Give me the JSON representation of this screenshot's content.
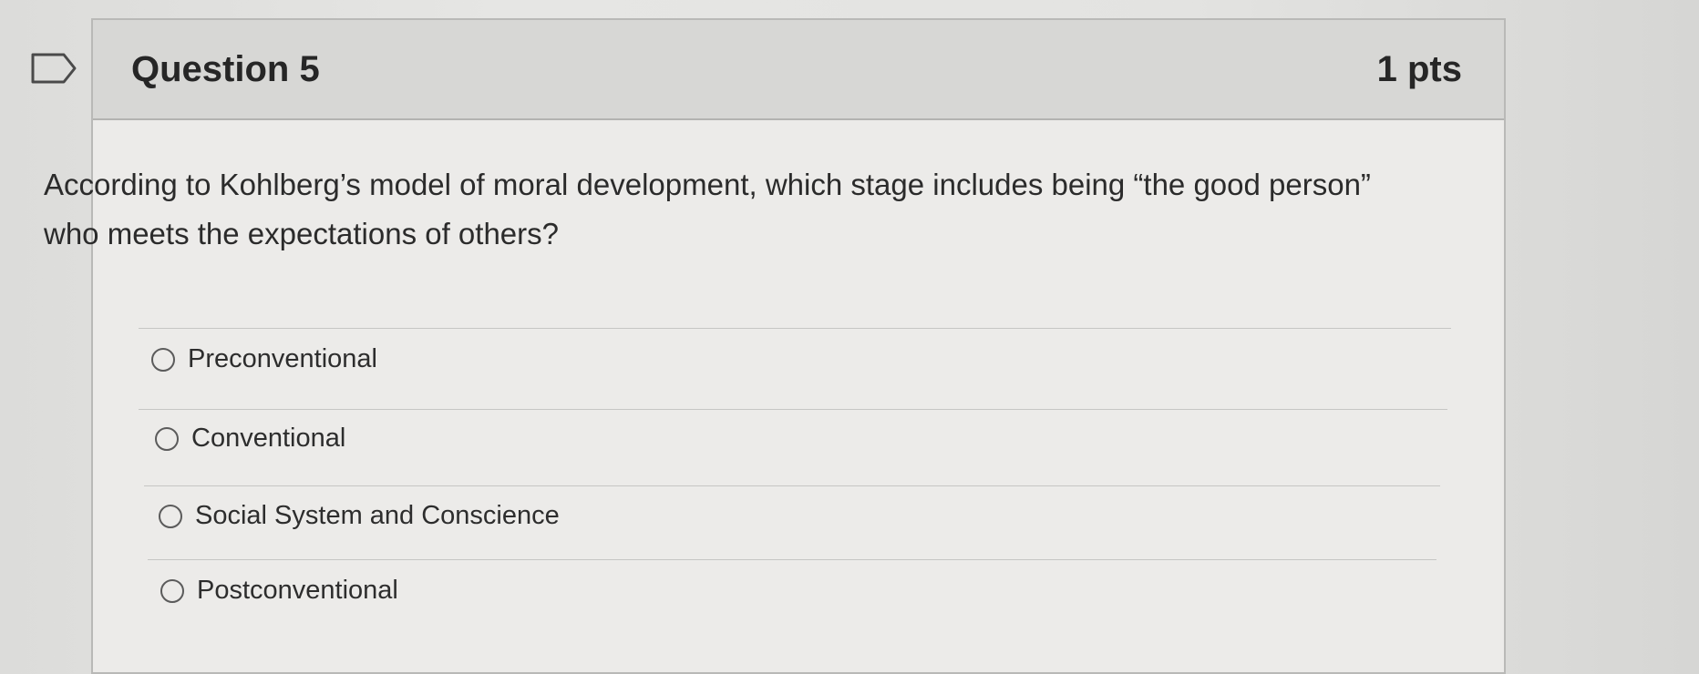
{
  "question": {
    "title": "Question 5",
    "points": "1 pts",
    "text": "According to Kohlberg’s model of moral development, which stage includes being “the good person” who meets the expectations of others?"
  },
  "answers": [
    {
      "label": "Preconventional",
      "selected": false
    },
    {
      "label": "Conventional",
      "selected": false
    },
    {
      "label": "Social System and Conscience",
      "selected": false
    },
    {
      "label": "Postconventional",
      "selected": false
    }
  ],
  "icons": {
    "flag": "bookmark-flag-icon",
    "radio": "radio-button-icon"
  },
  "colors": {
    "header_bg": "#d7d7d5",
    "card_bg": "#ecebe9",
    "text": "#2b2b2b"
  }
}
